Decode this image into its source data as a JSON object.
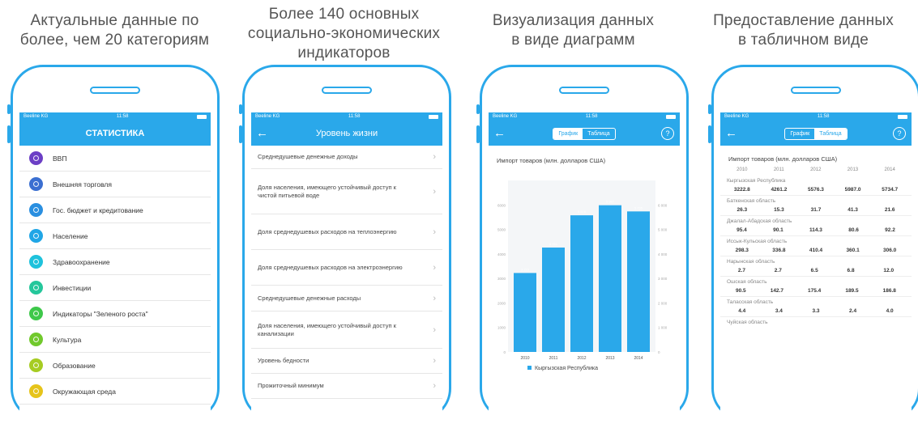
{
  "captions": [
    [
      "Актуальные данные по",
      "более, чем 20 категориям"
    ],
    [
      "Более 140 основных",
      "социально-экономических",
      "индикаторов"
    ],
    [
      "Визуализация данных",
      "в виде диаграмм"
    ],
    [
      "Предоставление данных",
      "в табличном виде"
    ]
  ],
  "status": {
    "carrier": "Beeline KG",
    "time": "11:58"
  },
  "screen1": {
    "title": "СТАТИСТИКА",
    "items": [
      {
        "label": "ВВП",
        "color": "#6c3fc5"
      },
      {
        "label": "Внешняя торговля",
        "color": "#3b6fd1"
      },
      {
        "label": "Гос. бюджет и кредитование",
        "color": "#2a8fe0"
      },
      {
        "label": "Население",
        "color": "#20a6e6"
      },
      {
        "label": "Здравоохранение",
        "color": "#1ec2dc"
      },
      {
        "label": "Инвестиции",
        "color": "#25c79b"
      },
      {
        "label": "Индикаторы \"Зеленого роста\"",
        "color": "#3ec84a"
      },
      {
        "label": "Культура",
        "color": "#71c92c"
      },
      {
        "label": "Образование",
        "color": "#a6cc22"
      },
      {
        "label": "Окружающая среда",
        "color": "#e6c41a"
      }
    ]
  },
  "screen2": {
    "title": "Уровень жизни",
    "back": "←",
    "items": [
      "Среднедушевые денежные доходы",
      "Доля населения, имеющего устойчивый доступ к чистой питьевой воде",
      "Доля среднедушевых расходов на теплоэнергию",
      "Доля среднедушевых расходов на электроэнергию",
      "Среднедушевые денежные расходы",
      "Доля населения, имеющего устойчивый доступ к канализации",
      "Уровень бедности",
      "Прожиточный минимум"
    ]
  },
  "segment": {
    "chart": "График",
    "table": "Таблица",
    "help": "?"
  },
  "screen3": {
    "chart_title": "Импорт товаров (млн. долларов США)"
  },
  "chart_data": {
    "type": "bar",
    "title": "Импорт товаров (млн. долларов США)",
    "categories": [
      "2010",
      "2011",
      "2012",
      "2013",
      "2014"
    ],
    "series": [
      {
        "name": "Кыргызская Республика",
        "values": [
          3222.8,
          4261.2,
          5576.3,
          5987.0,
          5734.7
        ]
      }
    ],
    "value_labels": [
      "3 223",
      "4 261",
      "5 576",
      "5 987",
      "5 735"
    ],
    "ylim": [
      0,
      7000
    ],
    "left_ticks": [
      "0",
      "1000",
      "2000",
      "3000",
      "4000",
      "5000",
      "6000"
    ],
    "right_ticks": [
      "0",
      "1 000",
      "2 000",
      "3 000",
      "4 000",
      "5 000",
      "6 000"
    ],
    "color": "#2aa8ea",
    "legend": "bottom"
  },
  "screen4": {
    "title": "Импорт товаров (млн. долларов США)",
    "years": [
      "2010",
      "2011",
      "2012",
      "2013",
      "2014"
    ],
    "rows": [
      {
        "region": "Кыргызская Республика",
        "values": [
          "3222.8",
          "4261.2",
          "5576.3",
          "5987.0",
          "5734.7"
        ]
      },
      {
        "region": "Баткенская область",
        "values": [
          "26.3",
          "15.3",
          "31.7",
          "41.3",
          "21.6"
        ]
      },
      {
        "region": "Джалал-Абадская область",
        "values": [
          "95.4",
          "90.1",
          "114.3",
          "80.6",
          "92.2"
        ]
      },
      {
        "region": "Иссык-Кульская область",
        "values": [
          "298.3",
          "336.8",
          "410.4",
          "360.1",
          "306.0"
        ]
      },
      {
        "region": "Нарынская область",
        "values": [
          "2.7",
          "2.7",
          "6.5",
          "6.8",
          "12.0"
        ]
      },
      {
        "region": "Ошская область",
        "values": [
          "90.5",
          "142.7",
          "175.4",
          "189.5",
          "186.8"
        ]
      },
      {
        "region": "Таласская область",
        "values": [
          "4.4",
          "3.4",
          "3.3",
          "2.4",
          "4.0"
        ]
      },
      {
        "region": "Чуйская область",
        "values": []
      }
    ]
  }
}
